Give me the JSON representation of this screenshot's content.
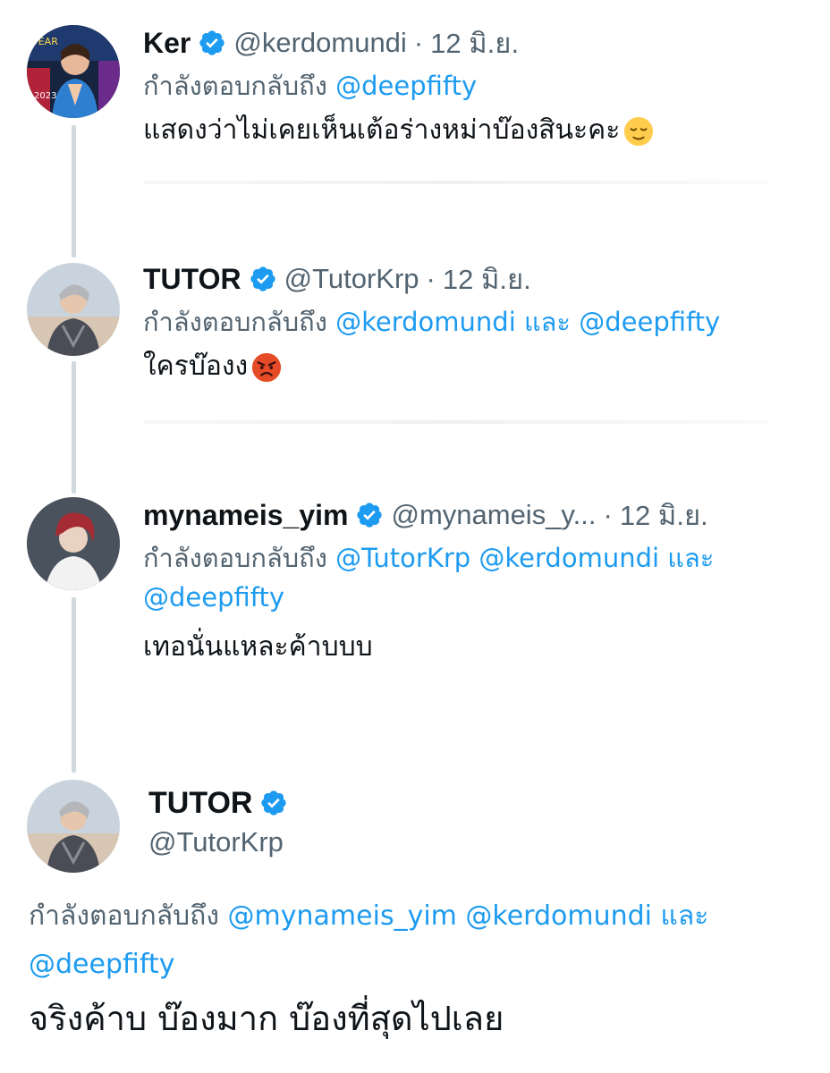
{
  "replies": [
    {
      "name": "Ker",
      "handle": "@kerdomundi",
      "date": "12 มิ.ย.",
      "reply_prefix": "กำลังตอบกลับถึง",
      "mentions_line1": "@deepfifty",
      "mentions_line2": "",
      "text": "แสดงว่าไม่เคยเห็นเต้อร่างหม่าบ๊องสินะคะ",
      "emoji": "relieved-face"
    },
    {
      "name": "TUTOR",
      "handle": "@TutorKrp",
      "date": "12 มิ.ย.",
      "reply_prefix": "กำลังตอบกลับถึง",
      "mentions_line1": "@kerdomundi และ @deepfifty",
      "mentions_line2": "",
      "text": "ใครบ๊องง",
      "emoji": "angry-face"
    },
    {
      "name": "mynameis_yim",
      "handle": "@mynameis_y...",
      "date": "12 มิ.ย.",
      "reply_prefix": "กำลังตอบกลับถึง",
      "mentions_line1": "@TutorKrp @kerdomundi และ",
      "mentions_line2": "@deepfifty",
      "text": "เทอนั่นแหละค้าบบบ",
      "emoji": ""
    }
  ],
  "main_tweet": {
    "name": "TUTOR",
    "handle": "@TutorKrp",
    "reply_prefix": "กำลังตอบกลับถึง",
    "mentions_line1": "@mynameis_yim @kerdomundi และ",
    "mentions_line2": "@deepfifty",
    "text": "จริงค้าบ บ๊องมาก บ๊องที่สุดไปเลย"
  },
  "separator": "·",
  "colors": {
    "accent": "#1d9bf0",
    "secondary_text": "#536471",
    "primary_text": "#0f1419",
    "thread_line": "#cfd9de"
  },
  "icons": {
    "verified": "verified-badge-icon"
  }
}
